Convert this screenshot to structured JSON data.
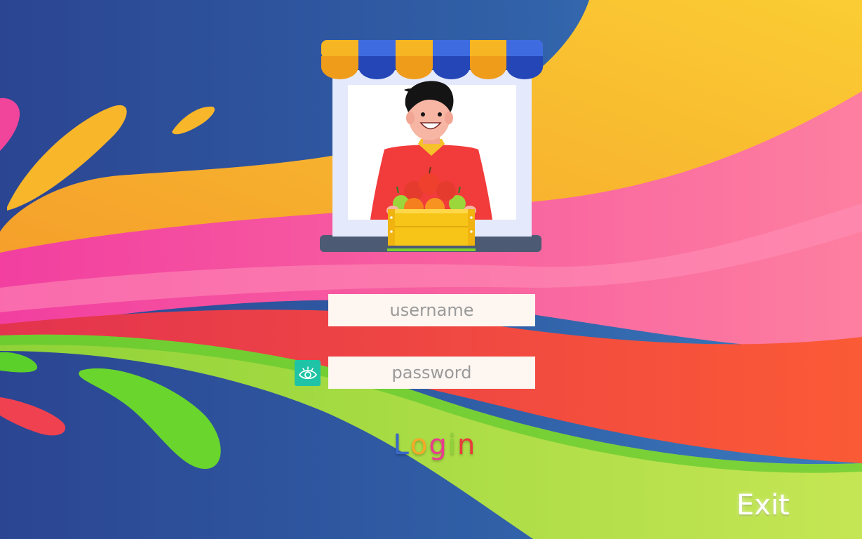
{
  "login_form": {
    "username_placeholder": "username",
    "password_placeholder": "password",
    "show_password_icon": "eye-icon"
  },
  "login_button": {
    "letters": [
      "L",
      "o",
      "g",
      "i",
      "n"
    ],
    "letter_colors": [
      "#3a68c9",
      "#f7a928",
      "#ea3a8f",
      "#8fd13a",
      "#e93b3b"
    ]
  },
  "exit_button": {
    "label": "Exit"
  },
  "theme": {
    "background_blue": "#2e4f9c",
    "field_bg": "#fdf6f1",
    "eye_button_bg": "#1fc3a6",
    "awning_yellow": "#f6b523",
    "awning_blue": "#3e6ce0"
  }
}
